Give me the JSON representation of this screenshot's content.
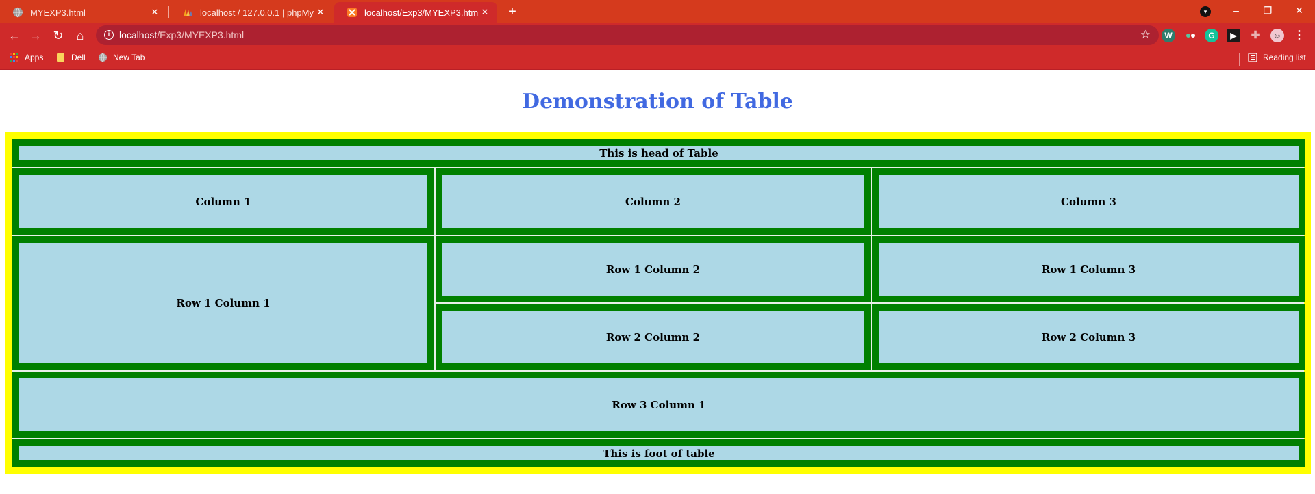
{
  "browser": {
    "tabs": [
      {
        "title": "MYEXP3.html",
        "active": false,
        "icon": "globe-icon"
      },
      {
        "title": "localhost / 127.0.0.1 | phpMyAdmin",
        "active": false,
        "icon": "phpmyadmin-icon"
      },
      {
        "title": "localhost/Exp3/MYEXP3.html",
        "active": true,
        "icon": "xampp-icon"
      }
    ],
    "newtab_symbol": "+",
    "window_controls": {
      "minimize": "–",
      "restore": "❐",
      "close": "✕"
    },
    "nav": {
      "back": "←",
      "forward": "→",
      "reload": "↻",
      "home": "⌂"
    },
    "address": {
      "host": "localhost",
      "path": "/Exp3/MYEXP3.html"
    },
    "bookmarks": [
      {
        "label": "Apps",
        "icon": "apps-grid-icon"
      },
      {
        "label": "Dell",
        "icon": "folder-icon"
      },
      {
        "label": "New Tab",
        "icon": "globe-icon"
      }
    ],
    "reading_list": "Reading list",
    "colors": {
      "tabstrip": "#d53a1d",
      "toolbar": "#cf2a2a",
      "omnibox": "#ad2130"
    }
  },
  "page": {
    "title": "Demonstration of Table",
    "colors": {
      "title": "#4169e1",
      "outer_border": "#ffff00",
      "cell_border": "#008000",
      "cell_bg": "#add8e6"
    },
    "table": {
      "head": "This is head of Table",
      "header_cells": [
        "Column 1",
        "Column 2",
        "Column 3"
      ],
      "row1": {
        "c1": "Row 1 Column 1",
        "c2": "Row 1 Column 2",
        "c3": "Row 1 Column 3"
      },
      "row2": {
        "c2": "Row 2 Column 2",
        "c3": "Row 2 Column 3"
      },
      "row3": {
        "c1": "Row 3 Column 1"
      },
      "foot": "This is foot of table"
    }
  }
}
